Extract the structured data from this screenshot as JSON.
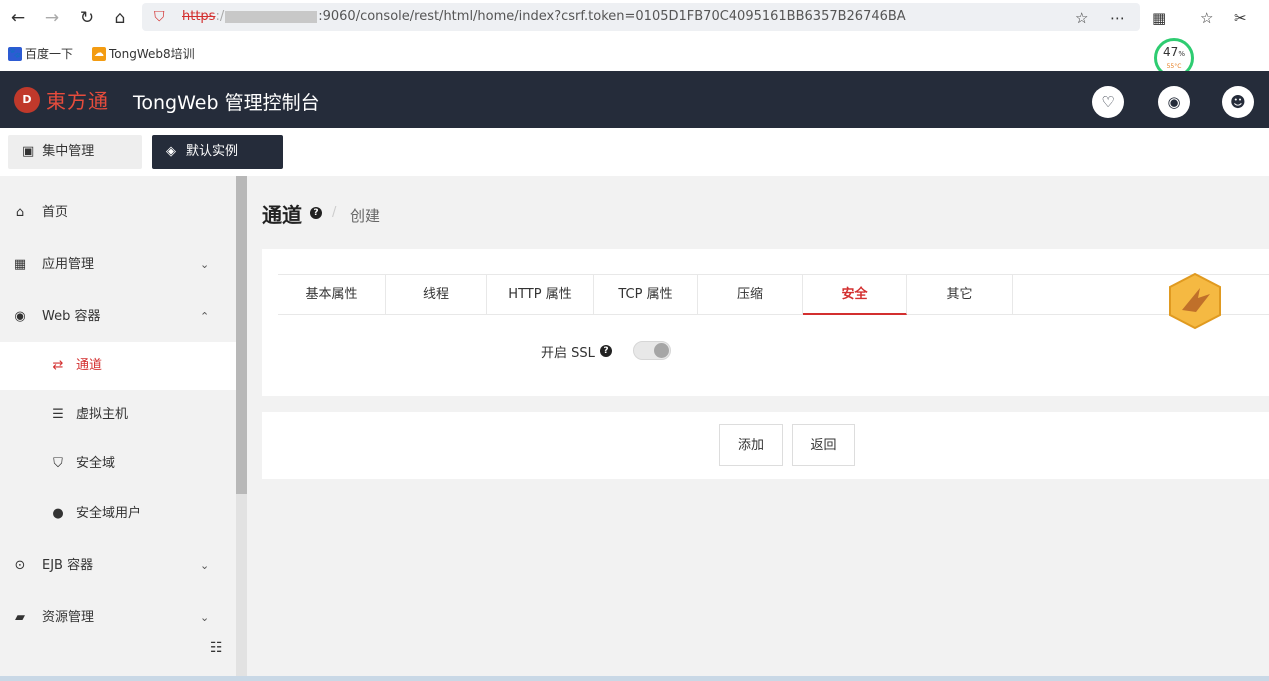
{
  "browser": {
    "url_scheme": "https",
    "url_rest": ":9060/console/rest/html/home/index?csrf.token=0105D1FB70C4095161BB6357B26746BA",
    "bookmarks": [
      {
        "label": "百度一下",
        "icon": "baidu-icon"
      },
      {
        "label": "TongWeb8培训",
        "icon": "folder-icon"
      }
    ],
    "cpu": {
      "percent": "47",
      "unit": "%",
      "temp": "55°C"
    }
  },
  "header": {
    "logo_text": "東方通",
    "title": "TongWeb 管理控制台",
    "buttons": [
      "bulb-icon",
      "globe-icon",
      "user-icon"
    ]
  },
  "toolbar": {
    "central_label": "集中管理",
    "default_instance_label": "默认实例"
  },
  "sidebar": {
    "items": [
      {
        "label": "首页",
        "icon": "home-icon"
      },
      {
        "label": "应用管理",
        "icon": "grid-icon",
        "chevron": "down"
      },
      {
        "label": "Web 容器",
        "icon": "globe-icon",
        "chevron": "up"
      },
      {
        "label": "通道",
        "icon": "exchange-icon",
        "active": true
      },
      {
        "label": "虚拟主机",
        "icon": "server-icon"
      },
      {
        "label": "安全域",
        "icon": "shield-icon"
      },
      {
        "label": "安全域用户",
        "icon": "user-icon"
      },
      {
        "label": "EJB 容器",
        "icon": "dot-circle-icon",
        "chevron": "down"
      },
      {
        "label": "资源管理",
        "icon": "book-icon",
        "chevron": "down"
      }
    ]
  },
  "page": {
    "title": "通道",
    "crumb": "创建"
  },
  "tabs": [
    "基本属性",
    "线程",
    "HTTP 属性",
    "TCP 属性",
    "压缩",
    "安全",
    "其它"
  ],
  "active_tab": "安全",
  "form": {
    "ssl_label": "开启 SSL",
    "ssl_enabled": false
  },
  "actions": {
    "add": "添加",
    "back": "返回"
  },
  "colors": {
    "header_bg": "#252c3a",
    "accent": "#d32f2f"
  }
}
